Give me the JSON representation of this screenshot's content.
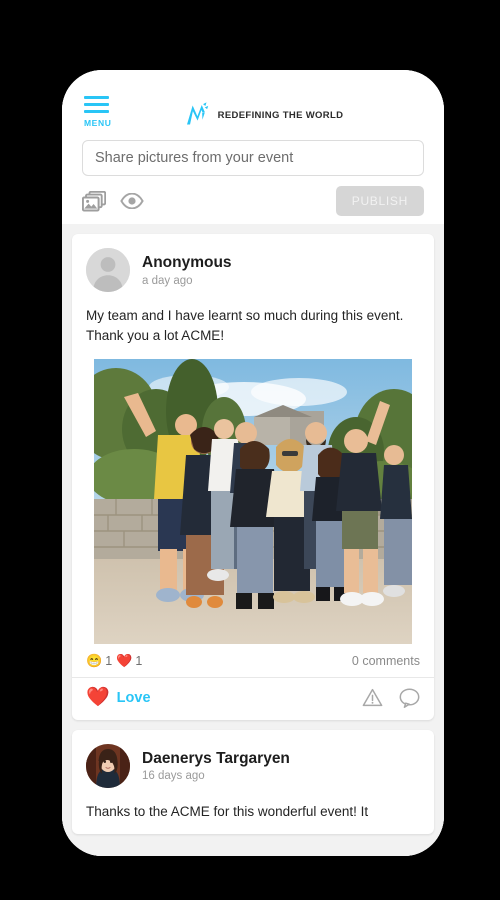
{
  "app": {
    "brand_name": "REDEFINING THE WORLD",
    "brand_mark": "n-logo-icon",
    "accent_color": "#29c5f6",
    "frame_color": "#000000",
    "feed_background": "#f2f2f2"
  },
  "header": {
    "menu_label": "MENU",
    "menu_icon": "hamburger-icon"
  },
  "composer": {
    "placeholder": "Share pictures from your event",
    "value": "",
    "image_icon": "photos-stack-icon",
    "visibility_icon": "eye-icon",
    "publish_label": "PUBLISH",
    "publish_enabled": false,
    "publish_bg": "#d6d6d6",
    "publish_text_color": "#f2f2f2"
  },
  "feed": {
    "posts": [
      {
        "author": "Anonymous",
        "time": "a day ago",
        "avatar_type": "placeholder-person-icon",
        "body": "My team and I have learnt so much during this event. Thank you a lot ACME!",
        "photo_alt": "group-photo-of-ten-people-outdoors",
        "reactions": [
          {
            "emoji": "😁",
            "name": "grinning-face-emoji",
            "count": "1"
          },
          {
            "emoji": "❤️",
            "name": "red-heart-emoji",
            "count": "1"
          }
        ],
        "comments_label": "0 comments",
        "love_emoji": "❤️",
        "love_label": "Love",
        "report_icon": "report-warning-icon",
        "comment_icon": "comment-bubble-icon"
      },
      {
        "author": "Daenerys Targaryen",
        "time": "16 days ago",
        "avatar_type": "user-photo-avatar",
        "body": "Thanks to the ACME for this wonderful event! It"
      }
    ]
  }
}
